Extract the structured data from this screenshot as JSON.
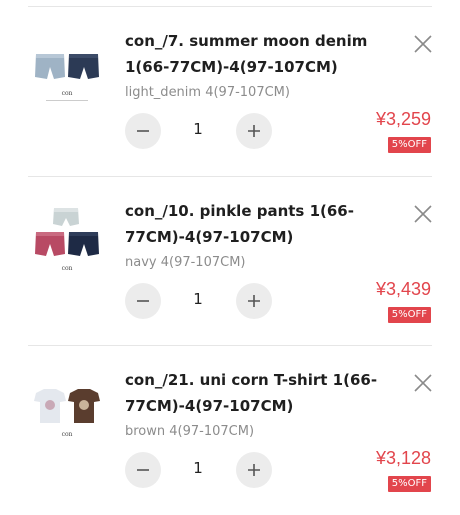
{
  "cart": {
    "items": [
      {
        "title": "con_/7. summer moon denim 1(66-77CM)-4(97-107CM)",
        "variant": "light_denim 4(97-107CM)",
        "quantity": "1",
        "price": "¥3,259",
        "discount": "5%OFF",
        "thumb_logo": "con"
      },
      {
        "title": "con_/10. pinkle pants 1(66-77CM)-4(97-107CM)",
        "variant": "navy 4(97-107CM)",
        "quantity": "1",
        "price": "¥3,439",
        "discount": "5%OFF",
        "thumb_logo": "con"
      },
      {
        "title": "con_/21. uni corn T-shirt 1(66-77CM)-4(97-107CM)",
        "variant": "brown 4(97-107CM)",
        "quantity": "1",
        "price": "¥3,128",
        "discount": "5%OFF",
        "thumb_logo": "con"
      }
    ]
  },
  "icons": {
    "remove": "close-icon",
    "decrease": "minus-icon",
    "increase": "plus-icon"
  },
  "colors": {
    "price": "#e2454c",
    "badge": "#e2454c",
    "stepper": "#ececec"
  }
}
